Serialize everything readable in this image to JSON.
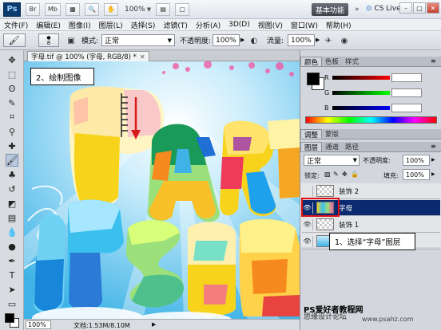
{
  "titlebar": {
    "logo": "Ps",
    "zoom": "100%",
    "workspace": "基本功能",
    "cs_live": "CS Live"
  },
  "menu": [
    "文件(F)",
    "编辑(E)",
    "图像(I)",
    "图层(L)",
    "选择(S)",
    "滤镜(T)",
    "分析(A)",
    "3D(D)",
    "视图(V)",
    "窗口(W)",
    "帮助(H)"
  ],
  "options": {
    "brush_size": "8",
    "mode_label": "模式:",
    "mode_value": "正常",
    "opacity_label": "不透明度:",
    "opacity_value": "100%",
    "flow_label": "流量:",
    "flow_value": "100%"
  },
  "document": {
    "tab_title": "字母.tif @ 100% (字母, RGB/8) *",
    "status_zoom": "100%",
    "status_doc": "文档:1.53M/8.10M"
  },
  "annotations": {
    "step2": "2、绘制图像",
    "step1": "1、选择“字母”图层"
  },
  "color_panel": {
    "tabs": [
      "颜色",
      "色板",
      "样式"
    ],
    "labels": [
      "R",
      "G",
      "B"
    ],
    "values": [
      "",
      "",
      ""
    ],
    "fg_color": "#000000",
    "bg_color": "#ffffff"
  },
  "adjust_tabs": [
    "调整",
    "蒙版"
  ],
  "layers_panel": {
    "tabs": [
      "图层",
      "通道",
      "路径"
    ],
    "blend_mode": "正常",
    "opacity_label": "不透明度:",
    "opacity_value": "100%",
    "lock_label": "锁定:",
    "fill_label": "填充:",
    "fill_value": "100%",
    "layers": [
      {
        "name": "装饰 2",
        "visible": false,
        "selected": false
      },
      {
        "name": "字母",
        "visible": true,
        "selected": true
      },
      {
        "name": "装饰 1",
        "visible": true,
        "selected": false
      },
      {
        "name": "",
        "visible": true,
        "selected": false
      }
    ]
  },
  "watermark": {
    "line1": "PS爱好者教程网",
    "line2": "思缘设计论坛",
    "line3": "www.psahz.com"
  }
}
